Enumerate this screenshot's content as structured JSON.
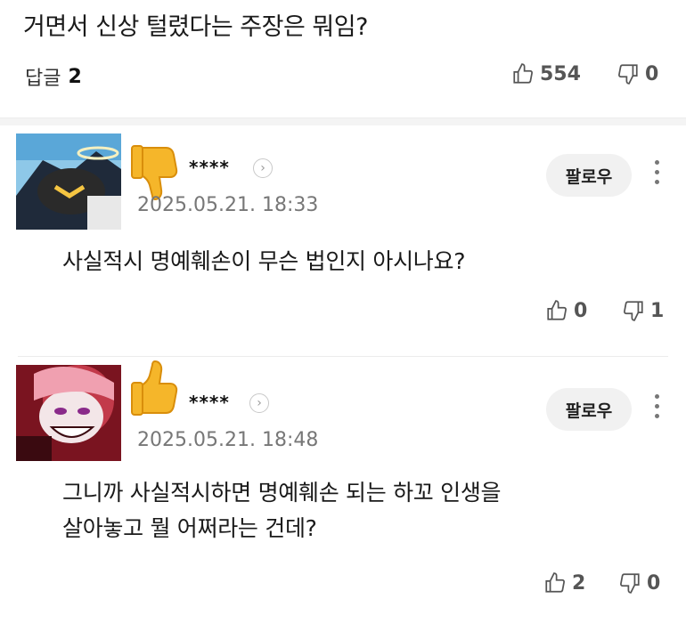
{
  "top_comment": {
    "text": "거면서 신상 털렸다는 주장은 뭐임?",
    "reply_label": "답글",
    "reply_count": "2",
    "likes": "554",
    "dislikes": "0"
  },
  "replies": [
    {
      "username": "****",
      "date": "2025.05.21. 18:33",
      "follow_label": "팔로우",
      "text": "사실적시 명예훼손이 무슨 법인지 아시나요?",
      "likes": "0",
      "dislikes": "1",
      "emoji": "thumbs-down"
    },
    {
      "username": "****",
      "date": "2025.05.21. 18:48",
      "follow_label": "팔로우",
      "text_lines": [
        "그니까 사실적시하면 명예훼손 되는 하꼬 인생을",
        "살아놓고 뭘 어쩌라는 건데?"
      ],
      "likes": "2",
      "dislikes": "0",
      "emoji": "thumbs-up"
    }
  ],
  "colors": {
    "emoji_yellow": "#f5b62a",
    "follow_bg": "#f1f1f1",
    "divider": "#f4f4f4"
  }
}
